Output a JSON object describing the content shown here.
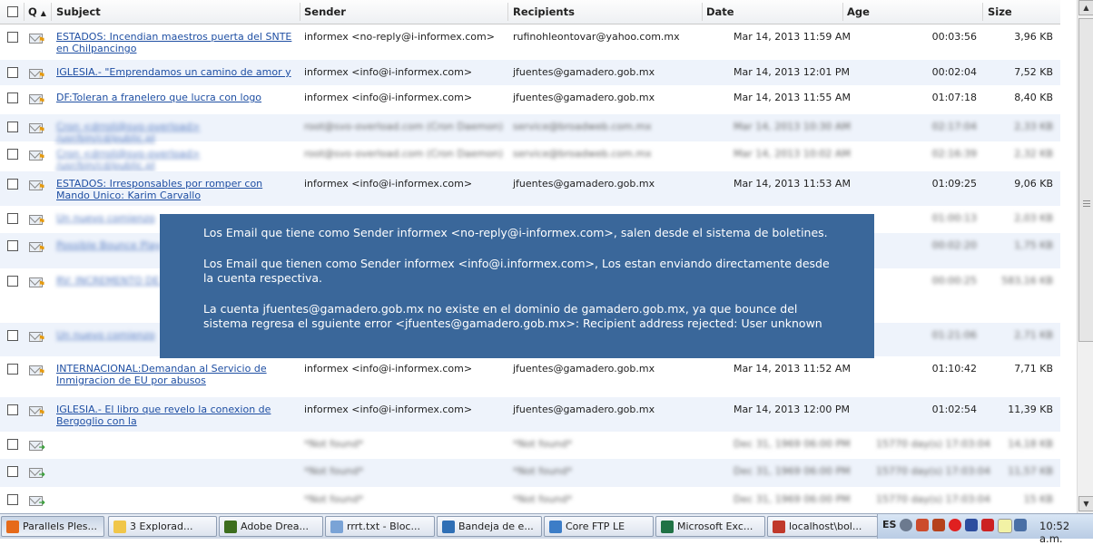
{
  "header": {
    "q": "Q",
    "sort_indicator": "▲",
    "subject": "Subject",
    "sender": "Sender",
    "recipients": "Recipients",
    "date": "Date",
    "age": "Age",
    "size": "Size"
  },
  "rows": [
    {
      "subject": "ESTADOS: Incendian maestros puerta del SNTE en Chilpancingo",
      "sender": "informex <no-reply@i-informex.com>",
      "recipients": "rufinohleontovar@yahoo.com.mx",
      "date": "Mar 14, 2013 11:59 AM",
      "age": "00:03:56",
      "size": "3,96 KB"
    },
    {
      "subject": "IGLESIA.- \"Emprendamos un camino de amor y",
      "sender": "informex <info@i-informex.com>",
      "recipients": "jfuentes@gamadero.gob.mx",
      "date": "Mar 14, 2013 12:01 PM",
      "age": "00:02:04",
      "size": "7,52 KB"
    },
    {
      "subject": "DF:Toleran a franelero que lucra con logo",
      "sender": "informex <info@i-informex.com>",
      "recipients": "jfuentes@gamadero.gob.mx",
      "date": "Mar 14, 2013 11:55 AM",
      "age": "01:07:18",
      "size": "8,40 KB"
    },
    {
      "subject": "Cron <drroli@svo-overload> /usr/bin/cd/public.pl",
      "sender": "root@svo-overload.com (Cron Daemon)",
      "recipients": "service@broadweb.com.mx",
      "date": "Mar 14, 2013 10:30 AM",
      "age": "02:17:04",
      "size": "2,33 KB"
    },
    {
      "subject": "Cron <drroli@svo-overload> /usr/bin/cd/public.pl",
      "sender": "root@svo-overload.com (Cron Daemon)",
      "recipients": "service@broadweb.com.mx",
      "date": "Mar 14, 2013 10:02 AM",
      "age": "02:16:39",
      "size": "2,32 KB"
    },
    {
      "subject": "ESTADOS: Irresponsables por romper con Mando Unico: Karim Carvallo",
      "sender": "informex <info@i-informex.com>",
      "recipients": "jfuentes@gamadero.gob.mx",
      "date": "Mar 14, 2013 11:53 AM",
      "age": "01:09:25",
      "size": "9,06 KB"
    },
    {
      "subject": "Un nuevo comienzo",
      "sender": "",
      "recipients": "",
      "date": "",
      "age": "01:00:13",
      "size": "2,03 KB"
    },
    {
      "subject": "Possible Bounce Play",
      "sender": "",
      "recipients": "",
      "date": "",
      "age": "00:02:20",
      "size": "1,75 KB"
    },
    {
      "subject": "RV: INCREMENTO DE PRECIO",
      "sender": "",
      "recipients": "",
      "date": "",
      "age": "00:00:25",
      "size": "583,16 KB"
    },
    {
      "subject": "Un nuevo comienzo",
      "sender": "",
      "recipients": "",
      "date": "",
      "age": "01:21:06",
      "size": "2,71 KB"
    },
    {
      "subject": "INTERNACIONAL:Demandan al Servicio de Inmigracion de EU por abusos",
      "sender": "informex <info@i-informex.com>",
      "recipients": "jfuentes@gamadero.gob.mx",
      "date": "Mar 14, 2013 11:52 AM",
      "age": "01:10:42",
      "size": "7,71 KB"
    },
    {
      "subject": "IGLESIA.- El libro que revelo la conexion de Bergoglio con la",
      "sender": "informex <info@i-informex.com>",
      "recipients": "jfuentes@gamadero.gob.mx",
      "date": "Mar 14, 2013 12:00 PM",
      "age": "01:02:54",
      "size": "11,39 KB"
    },
    {
      "subject": "",
      "sender": "*Not found*",
      "recipients": "*Not found*",
      "date": "Dec 31, 1969 06:00 PM",
      "age": "15770 day(s) 17:03:04",
      "size": "14,18 KB"
    },
    {
      "subject": "",
      "sender": "*Not found*",
      "recipients": "*Not found*",
      "date": "Dec 31, 1969 06:00 PM",
      "age": "15770 day(s) 17:03:04",
      "size": "11,57 KB"
    },
    {
      "subject": "",
      "sender": "*Not found*",
      "recipients": "*Not found*",
      "date": "Dec 31, 1969 06:00 PM",
      "age": "15770 day(s) 17:03:04",
      "size": "15 KB"
    }
  ],
  "popup": {
    "line1": "Los Email que tiene como Sender informex <no-reply@i-informex.com>, salen desde el sistema de boletines.",
    "line2": "Los Email que tienen como Sender informex <info@i.informex.com>, Los estan enviando directamente desde\nla cuenta respectiva.",
    "line3": "La cuenta jfuentes@gamadero.gob.mx no existe en el dominio de gamadero.gob.mx, ya que bounce del\nsistema regresa el sguiente error  <jfuentes@gamadero.gob.mx>: Recipient address   rejected: User unknown"
  },
  "taskbar": {
    "items": [
      {
        "label": "Parallels Ples...",
        "icon": "firefox-icon",
        "color": "#e66a1a"
      },
      {
        "label": "3 Explorad...",
        "icon": "folder-icon",
        "color": "#f0c64a"
      },
      {
        "label": "Adobe Drea...",
        "icon": "dreamweaver-icon",
        "color": "#3d6e1e"
      },
      {
        "label": "rrrt.txt - Bloc...",
        "icon": "notepad-icon",
        "color": "#7aa3d6"
      },
      {
        "label": "Bandeja de e...",
        "icon": "mail-icon",
        "color": "#2f6fb5"
      },
      {
        "label": "Core FTP LE",
        "icon": "ftp-icon",
        "color": "#3c7dc7"
      },
      {
        "label": "Microsoft Exc...",
        "icon": "excel-icon",
        "color": "#207245"
      },
      {
        "label": "localhost\\bol...",
        "icon": "db-icon",
        "color": "#c0392b"
      }
    ],
    "lang": "ES",
    "clock": "10:52 a.m."
  },
  "colors": {
    "link": "#1f4fa3",
    "alt_row": "#eef3fb",
    "popup": "#3a679a"
  }
}
